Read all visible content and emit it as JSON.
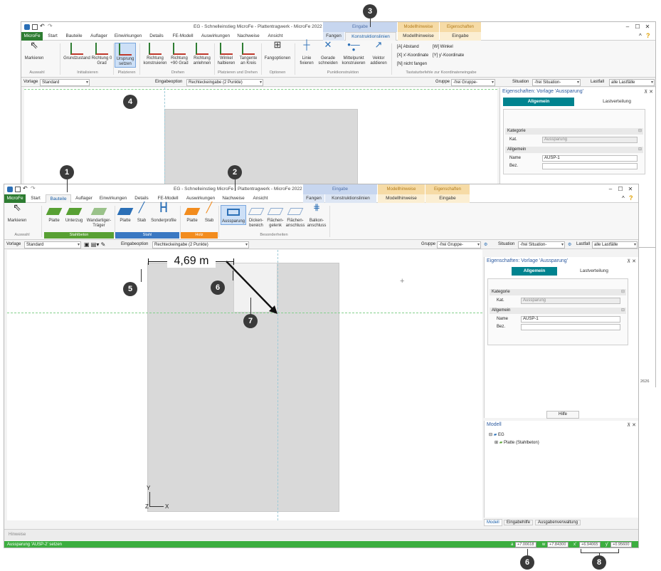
{
  "back_window": {
    "title": "EG - Schnelleinstieg MicroFe - Plattentragwerk - MicroFe 2022",
    "context_groups": {
      "eingabe": "Eingabe",
      "modellhinweise": "Modellhinweise",
      "eigenschaften": "Eigenschaften"
    },
    "tabs": [
      "MicroFe",
      "Start",
      "Bauteile",
      "Auflager",
      "Einwirkungen",
      "Details",
      "FE-Modell",
      "Auswirkungen",
      "Nachweise",
      "Ansicht",
      "Fangen",
      "Konstruktionslinien",
      "Modellhinweise",
      "Eingabe"
    ],
    "active_tab": "Konstruktionslinien",
    "ribbon_buttons": [
      {
        "label": "Markieren"
      },
      {
        "label": "Grundzustand"
      },
      {
        "label": "Richtung 0 Grad"
      },
      {
        "label": "Ursprung setzen"
      },
      {
        "label": "Richtung konstruieren"
      },
      {
        "label": "Richtung +90 Grad"
      },
      {
        "label": "Richtung anlehnen"
      },
      {
        "label": "Winkel halbieren"
      },
      {
        "label": "Tangente an Kreis"
      },
      {
        "label": "Fangoptionen"
      },
      {
        "label": "Linie fixieren"
      },
      {
        "label": "Gerade schneiden"
      },
      {
        "label": "Mittelpunkt konstruieren"
      },
      {
        "label": "Vektor addieren"
      }
    ],
    "ribbon_groups": [
      "Auswahl",
      "Initialisieren",
      "Platzieren",
      "Drehen",
      "Platzieren und Drehen",
      "Optionen",
      "Punktkonstruktion",
      "Tastaturbefehle zur Koordinateneingabe"
    ],
    "shortcuts": [
      "[A] Abstand",
      "[W] Winkel",
      "[X] x'-Koordinate",
      "[Y] y'-Koordinate",
      "[N] nicht fangen"
    ],
    "optbar": {
      "vorlage_label": "Vorlage",
      "vorlage_value": "Standard",
      "eingabeoption_label": "Eingabeoption",
      "eingabeoption_value": "Rechteckeingabe (2 Punkte)",
      "gruppe_label": "Gruppe",
      "gruppe_value": "-frei Gruppe-",
      "situation_label": "Situation",
      "situation_value": "-frei Situation-",
      "lastfall_label": "Lastfall",
      "lastfall_value": "alle Lastfälle"
    },
    "panel": {
      "title": "Eigenschaften: Vorlage 'Aussparung'",
      "tab_allgemein": "Allgemein",
      "tab_lastverteilung": "Lastverteilung",
      "kategorie": "Kategorie",
      "kat_label": "Kat.",
      "kat_value": "Aussparung",
      "allgemein": "Allgemein",
      "name_label": "Name",
      "name_value": "AUSP-1",
      "bez_label": "Bez."
    },
    "right_edge_value": "2626"
  },
  "front_window": {
    "title": "EG - Schnelleinstieg MicroFe - Plattentragwerk - MicroFe 2022",
    "context_groups": {
      "eingabe": "Eingabe",
      "modellhinweise": "Modellhinweise",
      "eigenschaften": "Eigenschaften"
    },
    "tabs": [
      "MicroFe",
      "Start",
      "Bauteile",
      "Auflager",
      "Einwirkungen",
      "Details",
      "FE-Modell",
      "Auswirkungen",
      "Nachweise",
      "Ansicht",
      "Fangen",
      "Konstruktionslinien",
      "Modellhinweise",
      "Eingabe"
    ],
    "active_tab": "Bauteile",
    "ribbon_buttons": [
      {
        "label": "Markieren"
      },
      {
        "label": "Platte"
      },
      {
        "label": "Unterzug"
      },
      {
        "label": "Wandartiger-Träger"
      },
      {
        "label": "Platte"
      },
      {
        "label": "Stab"
      },
      {
        "label": "Sonderprofile"
      },
      {
        "label": "Platte"
      },
      {
        "label": "Stab"
      },
      {
        "label": "Aussparung"
      },
      {
        "label": "Dicken-bereich"
      },
      {
        "label": "Flächen-gelenk"
      },
      {
        "label": "Flächen-anschluss"
      },
      {
        "label": "Balkon-anschluss"
      }
    ],
    "ribbon_groups": {
      "auswahl": "Auswahl",
      "stahlbeton": "Stahlbeton",
      "stahl": "Stahl",
      "holz": "Holz",
      "besonderheiten": "Besonderheiten"
    },
    "optbar": {
      "vorlage_label": "Vorlage",
      "vorlage_value": "Standard",
      "eingabeoption_label": "Eingabeoption",
      "eingabeoption_value": "Rechteckeingabe (2 Punkte)",
      "gruppe_label": "Gruppe",
      "gruppe_value": "-frei Gruppe-",
      "situation_label": "Situation",
      "situation_value": "-frei Situation-",
      "lastfall_label": "Lastfall",
      "lastfall_value": "alle Lastfälle"
    },
    "dimension": "4,69 m",
    "axis_y": "Y",
    "axis_x": "X",
    "axis_z": "Z",
    "panel": {
      "title": "Eigenschaften: Vorlage 'Aussparung'",
      "tab_allgemein": "Allgemein",
      "tab_lastverteilung": "Lastverteilung",
      "kategorie": "Kategorie",
      "kat_label": "Kat.",
      "kat_value": "Aussparung",
      "allgemein": "Allgemein",
      "name_label": "Name",
      "name_value": "AUSP-1",
      "bez_label": "Bez.",
      "hilfe": "Hilfe"
    },
    "model_panel": {
      "title": "Modell",
      "root": "EG",
      "child": "Platte (Stahlbeton)"
    },
    "bottom_tabs": [
      "Modell",
      "Eingabehilfe",
      "Ausgabenverwaltung"
    ],
    "hinweise": "Hinweise",
    "status_text": "Aussparung 'AUSP-2' setzen",
    "coords": [
      {
        "label": "a",
        "value": "+7.00618"
      },
      {
        "label": "w",
        "value": "+7.84300"
      },
      {
        "label": "x'",
        "value": "+6.94065"
      },
      {
        "label": "y'",
        "value": "+0.95600"
      }
    ]
  },
  "callouts": [
    "1",
    "2",
    "3",
    "4",
    "5",
    "6",
    "7",
    "6",
    "8"
  ],
  "colors": {
    "file_tab": "#2e7d32",
    "ctx_eingabe": "#c7d6ef",
    "ctx_modellhinweise": "#f6dba6",
    "status": "#3cae3f",
    "callout": "#3a3a3a"
  }
}
